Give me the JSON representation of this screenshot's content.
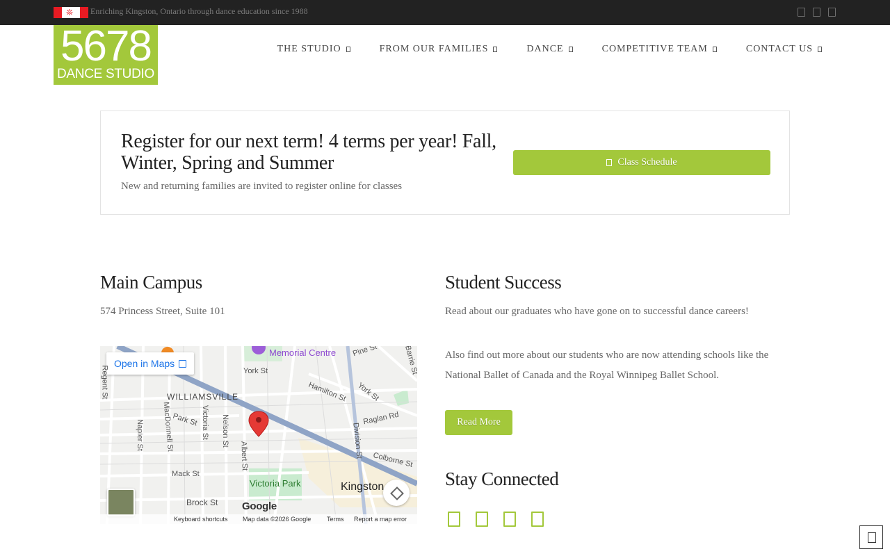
{
  "topbar": {
    "tagline": "Enriching Kingston, Ontario through dance education since 1988",
    "flag_icon": "canada-flag-icon",
    "social_icons": [
      "facebook-icon",
      "twitter-icon",
      "instagram-icon"
    ]
  },
  "logo": {
    "number": "5678",
    "subtitle": "DANCE STUDIO",
    "color": "#a3c83b"
  },
  "nav": {
    "items": [
      {
        "label": "THE STUDIO"
      },
      {
        "label": "FROM OUR FAMILIES"
      },
      {
        "label": "DANCE"
      },
      {
        "label": "COMPETITIVE TEAM"
      },
      {
        "label": "CONTACT US"
      }
    ]
  },
  "register": {
    "heading": "Register for our next term! 4 terms per year! Fall, Winter, Spring and Summer",
    "subtext": "New and returning families are invited to register online for classes",
    "button_label": "Class Schedule"
  },
  "main_campus": {
    "title": "Main Campus",
    "address": "574 Princess Street, Suite 101"
  },
  "map": {
    "open_maps_label": "Open in Maps",
    "google_label": "Google",
    "labels": {
      "memorial_centre": "Memorial Centre",
      "pine_st": "Pine St",
      "barrie_st": "Barrie St",
      "york_st": "York St",
      "york_st_2": "York St",
      "hamilton_st": "Hamilton St",
      "williamsville": "WILLIAMSVILLE",
      "regent_st": "Regent St",
      "park_st": "Park St",
      "victoria_st": "Victoria St",
      "nelson_st": "Nelson St",
      "napier_st": "Napier St",
      "macdonnell_st": "MacDonnell St",
      "raglan_rd": "Raglan Rd",
      "division_st": "Division St",
      "albert_st": "Albert St",
      "colborne_st": "Colborne St",
      "mack_st": "Mack St",
      "victoria_park": "Victoria Park",
      "kingston": "Kingston",
      "brock_st": "Brock St"
    },
    "footer": {
      "shortcuts": "Keyboard shortcuts",
      "map_data": "Map data ©2026 Google",
      "terms": "Terms",
      "report": "Report a map error"
    }
  },
  "student_success": {
    "title": "Student Success",
    "para1": "Read about our graduates who have gone on to successful dance careers!",
    "para2": "Also find out more about our students who are now attending schools like the National Ballet of Canada and the Royal Winnipeg Ballet School.",
    "button_label": "Read More"
  },
  "stay_connected": {
    "title": "Stay Connected",
    "icons": [
      "facebook-icon",
      "twitter-icon",
      "instagram-icon",
      "youtube-icon"
    ]
  },
  "accent_color": "#a3c83b"
}
